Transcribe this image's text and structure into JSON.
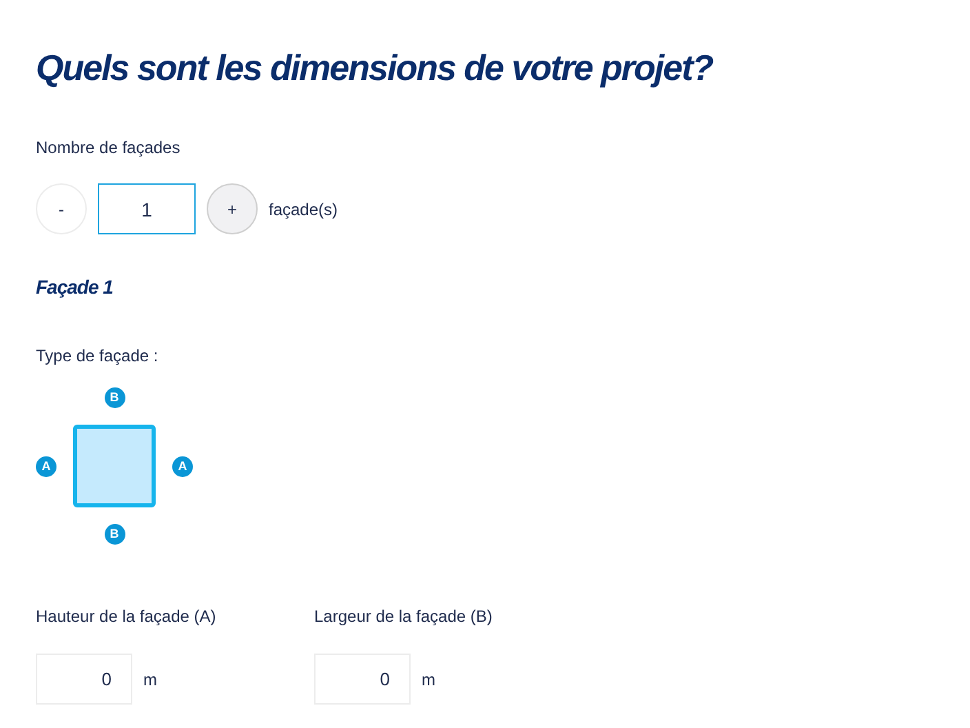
{
  "title": "Quels sont les dimensions de votre projet?",
  "facade_count": {
    "label": "Nombre de façades",
    "decrement": "-",
    "value": "1",
    "increment": "+",
    "unit": "façade(s)",
    "focused": true
  },
  "facade": {
    "heading": "Façade 1",
    "type_label": "Type de façade :",
    "type_diagram": {
      "selected": true,
      "top": "B",
      "left": "A",
      "right": "A",
      "bottom": "B"
    },
    "fields": [
      {
        "label": "Hauteur de la façade (A)",
        "value": "0",
        "unit": "m"
      },
      {
        "label": "Largeur de la façade (B)",
        "value": "0",
        "unit": "m"
      }
    ]
  }
}
